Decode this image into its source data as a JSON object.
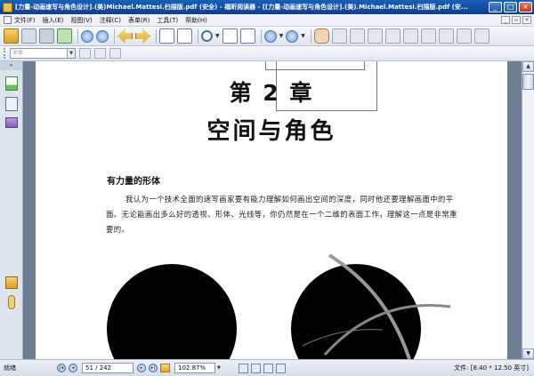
{
  "window": {
    "title": "[力量-动画速写与角色设计].(美)Michael.Mattesi.扫描版.pdf (安全) - 福昕阅读器 - [[力量-动画速写与角色设计].(美).Michael.Mattesi.扫描版.pdf (安..."
  },
  "menu": {
    "items": [
      "文件(F)",
      "插入(E)",
      "视图(V)",
      "注释(C)",
      "表单(R)",
      "工具(T)",
      "帮助(H)"
    ]
  },
  "toolbar2": {
    "font_placeholder": "宋体"
  },
  "document": {
    "chapter_number": "第 2 章",
    "chapter_title": "空间与角色",
    "section_heading": "有力量的形体",
    "paragraph": "我认为一个技术全面的速写画家要有能力理解如何画出空间的深度，同时他还要理解画面中的平面。无论能画出多么好的透视、形体、光线等，你仍然是在一个二维的表面工作，理解这一点是非常重要的。"
  },
  "status": {
    "ready": "就绪",
    "page_indicator": "51 / 242",
    "zoom": "102.87%",
    "file_size": "文件: [8.40 * 12.50 英寸]"
  }
}
